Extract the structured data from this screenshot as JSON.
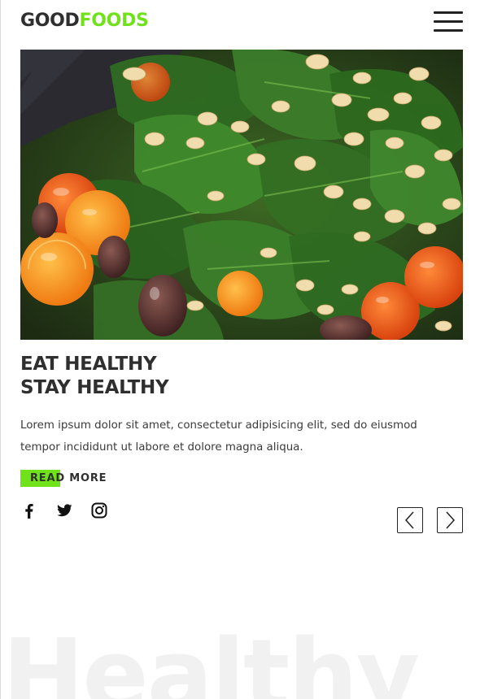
{
  "brand": {
    "part1": "GOOD",
    "part2": "FOODS",
    "accent_color": "#6fe21a",
    "text_color": "#2f2f2f"
  },
  "header": {
    "menu_icon": "hamburger-menu-icon"
  },
  "hero": {
    "image": "spinach-salad-with-cherry-tomatoes-olives-pine-nuts"
  },
  "main": {
    "headline_line1": "EAT HEALTHY",
    "headline_line2": "STAY HEALTHY",
    "description": "Lorem ipsum dolor sit amet, consectetur adipisicing elit, sed do eiusmod tempor incididunt ut labore et dolore magna aliqua.",
    "read_more_label": "READ MORE"
  },
  "socials": [
    {
      "icon": "facebook-icon"
    },
    {
      "icon": "twitter-icon"
    },
    {
      "icon": "instagram-icon"
    }
  ],
  "slider": {
    "prev_icon": "chevron-left-icon",
    "next_icon": "chevron-right-icon"
  },
  "watermark": "Healthy"
}
